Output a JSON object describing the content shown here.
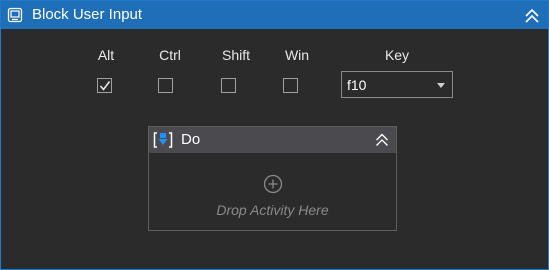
{
  "activity": {
    "title": "Block User Input",
    "modifiers": [
      {
        "label": "Alt",
        "checked": true
      },
      {
        "label": "Ctrl",
        "checked": false
      },
      {
        "label": "Shift",
        "checked": false
      },
      {
        "label": "Win",
        "checked": false
      }
    ],
    "key_label": "Key",
    "key_value": "f10"
  },
  "do_block": {
    "title": "Do",
    "drop_placeholder": "Drop Activity Here"
  },
  "colors": {
    "title_bar": "#1f6fb8",
    "background": "#2b2b2b",
    "do_header": "#4a4a4f",
    "accent_blue": "#1e90ff"
  }
}
